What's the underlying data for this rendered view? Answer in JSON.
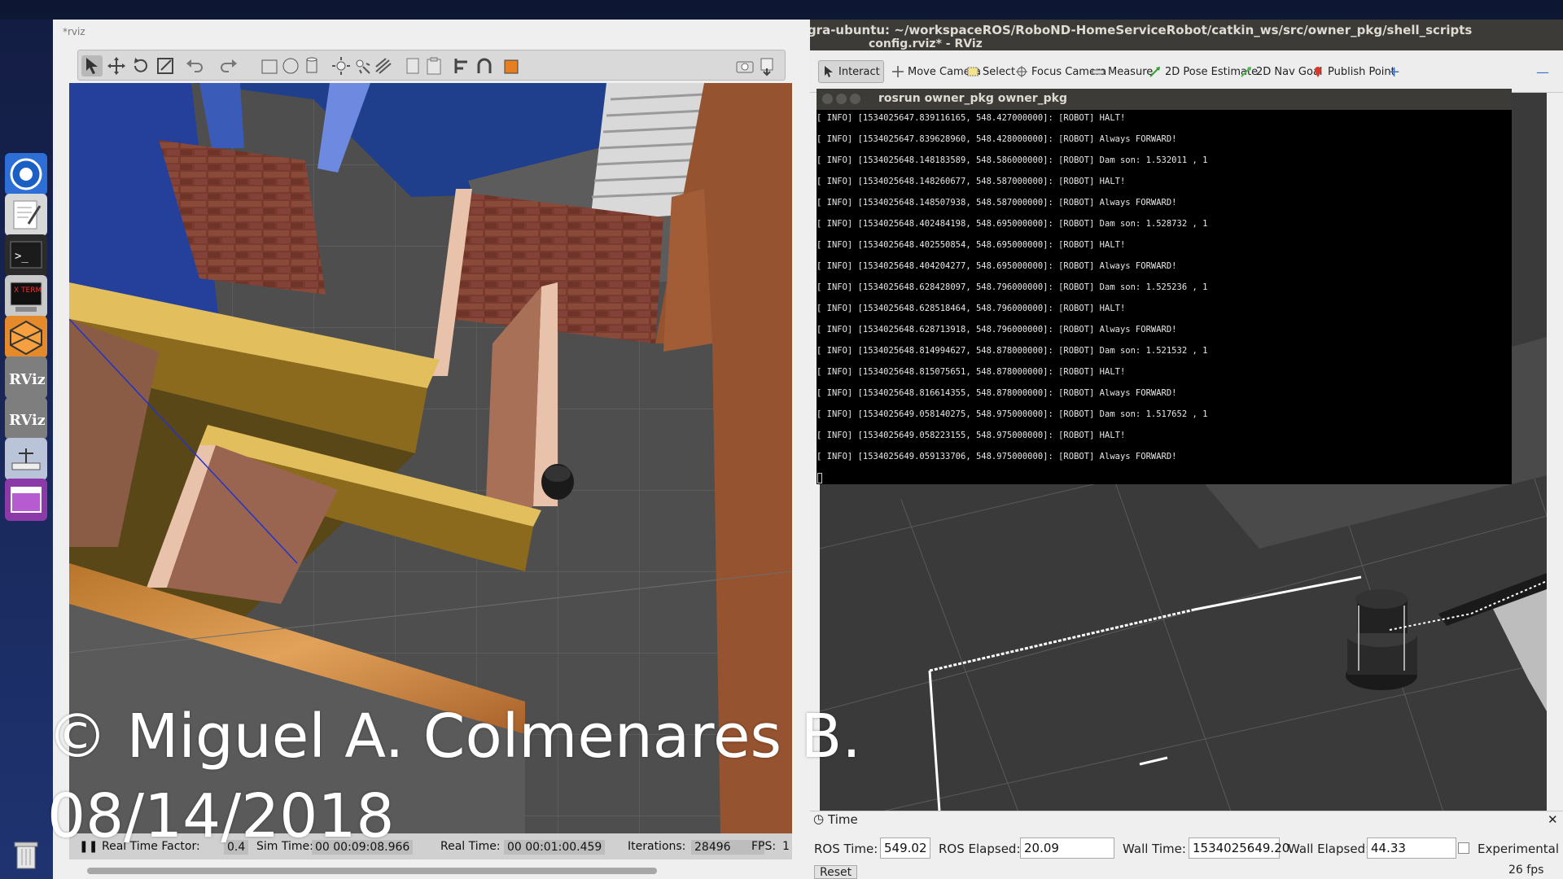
{
  "desktop": {
    "launcher": [
      {
        "name": "chromium-icon"
      },
      {
        "name": "text-editor-icon"
      },
      {
        "name": "terminal-icon"
      },
      {
        "name": "xterm-icon",
        "label": "X TERM"
      },
      {
        "name": "gazebo-icon"
      },
      {
        "name": "rviz-icon",
        "label": "RViz"
      },
      {
        "name": "rviz-icon-2",
        "label": "RViz"
      },
      {
        "name": "rqt-icon"
      },
      {
        "name": "workspace-icon"
      },
      {
        "name": "trash-icon"
      }
    ]
  },
  "gazebo": {
    "window_title_fragment": "*rviz",
    "status": {
      "real_time_factor_label": "Real Time Factor:",
      "real_time_factor_value": "0.4",
      "sim_time_label": "Sim Time:",
      "sim_time_value": "00 00:09:08.966",
      "real_time_label": "Real Time:",
      "real_time_value": "00 00:01:00.459",
      "iterations_label": "Iterations:",
      "iterations_value": "28496",
      "fps_label": "FPS:",
      "fps_value": "1"
    }
  },
  "terminal_main": {
    "title": "nvidia@tegra-ubuntu: ~/workspaceROS/RoboND-HomeServiceRobot/catkin_ws/src/owner_pkg/shell_scripts"
  },
  "rviz": {
    "title": "config.rviz* - RViz",
    "tools": [
      {
        "label": "Interact",
        "icon": "cursor-icon",
        "active": true
      },
      {
        "label": "Move Camera",
        "icon": "move-camera-icon"
      },
      {
        "label": "Select",
        "icon": "select-icon"
      },
      {
        "label": "Focus Camera",
        "icon": "focus-camera-icon"
      },
      {
        "label": "Measure",
        "icon": "ruler-icon"
      },
      {
        "label": "2D Pose Estimate",
        "icon": "pose-arrow-icon"
      },
      {
        "label": "2D Nav Goal",
        "icon": "nav-goal-icon"
      },
      {
        "label": "Publish Point",
        "icon": "map-pin-icon"
      }
    ],
    "time_panel": {
      "title": "Time",
      "ros_time_label": "ROS Time:",
      "ros_time": "549.02",
      "ros_elapsed_label": "ROS Elapsed:",
      "ros_elapsed": "20.09",
      "wall_time_label": "Wall Time:",
      "wall_time": "1534025649.20",
      "wall_elapsed_label": "Wall Elapsed:",
      "wall_elapsed": "44.33",
      "experimental_label": "Experimental",
      "reset_label": "Reset",
      "fps": "26 fps"
    }
  },
  "terminal_overlay": {
    "title": "rosrun owner_pkg owner_pkg",
    "lines": [
      "[ INFO] [1534025647.839116165, 548.427000000]: [ROBOT] HALT!",
      "[ INFO] [1534025647.839628960, 548.428000000]: [ROBOT] Always FORWARD!",
      "[ INFO] [1534025648.148183589, 548.586000000]: [ROBOT] Dam son: 1.532011 , 1",
      "[ INFO] [1534025648.148260677, 548.587000000]: [ROBOT] HALT!",
      "[ INFO] [1534025648.148507938, 548.587000000]: [ROBOT] Always FORWARD!",
      "[ INFO] [1534025648.402484198, 548.695000000]: [ROBOT] Dam son: 1.528732 , 1",
      "[ INFO] [1534025648.402550854, 548.695000000]: [ROBOT] HALT!",
      "[ INFO] [1534025648.404204277, 548.695000000]: [ROBOT] Always FORWARD!",
      "[ INFO] [1534025648.628428097, 548.796000000]: [ROBOT] Dam son: 1.525236 , 1",
      "[ INFO] [1534025648.628518464, 548.796000000]: [ROBOT] HALT!",
      "[ INFO] [1534025648.628713918, 548.796000000]: [ROBOT] Always FORWARD!",
      "[ INFO] [1534025648.814994627, 548.878000000]: [ROBOT] Dam son: 1.521532 , 1",
      "[ INFO] [1534025648.815075651, 548.878000000]: [ROBOT] HALT!",
      "[ INFO] [1534025648.816614355, 548.878000000]: [ROBOT] Always FORWARD!",
      "[ INFO] [1534025649.058140275, 548.975000000]: [ROBOT] Dam son: 1.517652 , 1",
      "[ INFO] [1534025649.058223155, 548.975000000]: [ROBOT] HALT!",
      "[ INFO] [1534025649.059133706, 548.975000000]: [ROBOT] Always FORWARD!"
    ]
  },
  "watermark": {
    "line1": "© Miguel A. Colmenares B.",
    "line2": "08/14/2018"
  },
  "colors": {
    "terminal_bg": "#000000",
    "titlebar": "#3c3b37",
    "brick": "#7a3a2e",
    "wall_yellow": "#c9a24a",
    "wall_blue": "#2d4a9a"
  }
}
